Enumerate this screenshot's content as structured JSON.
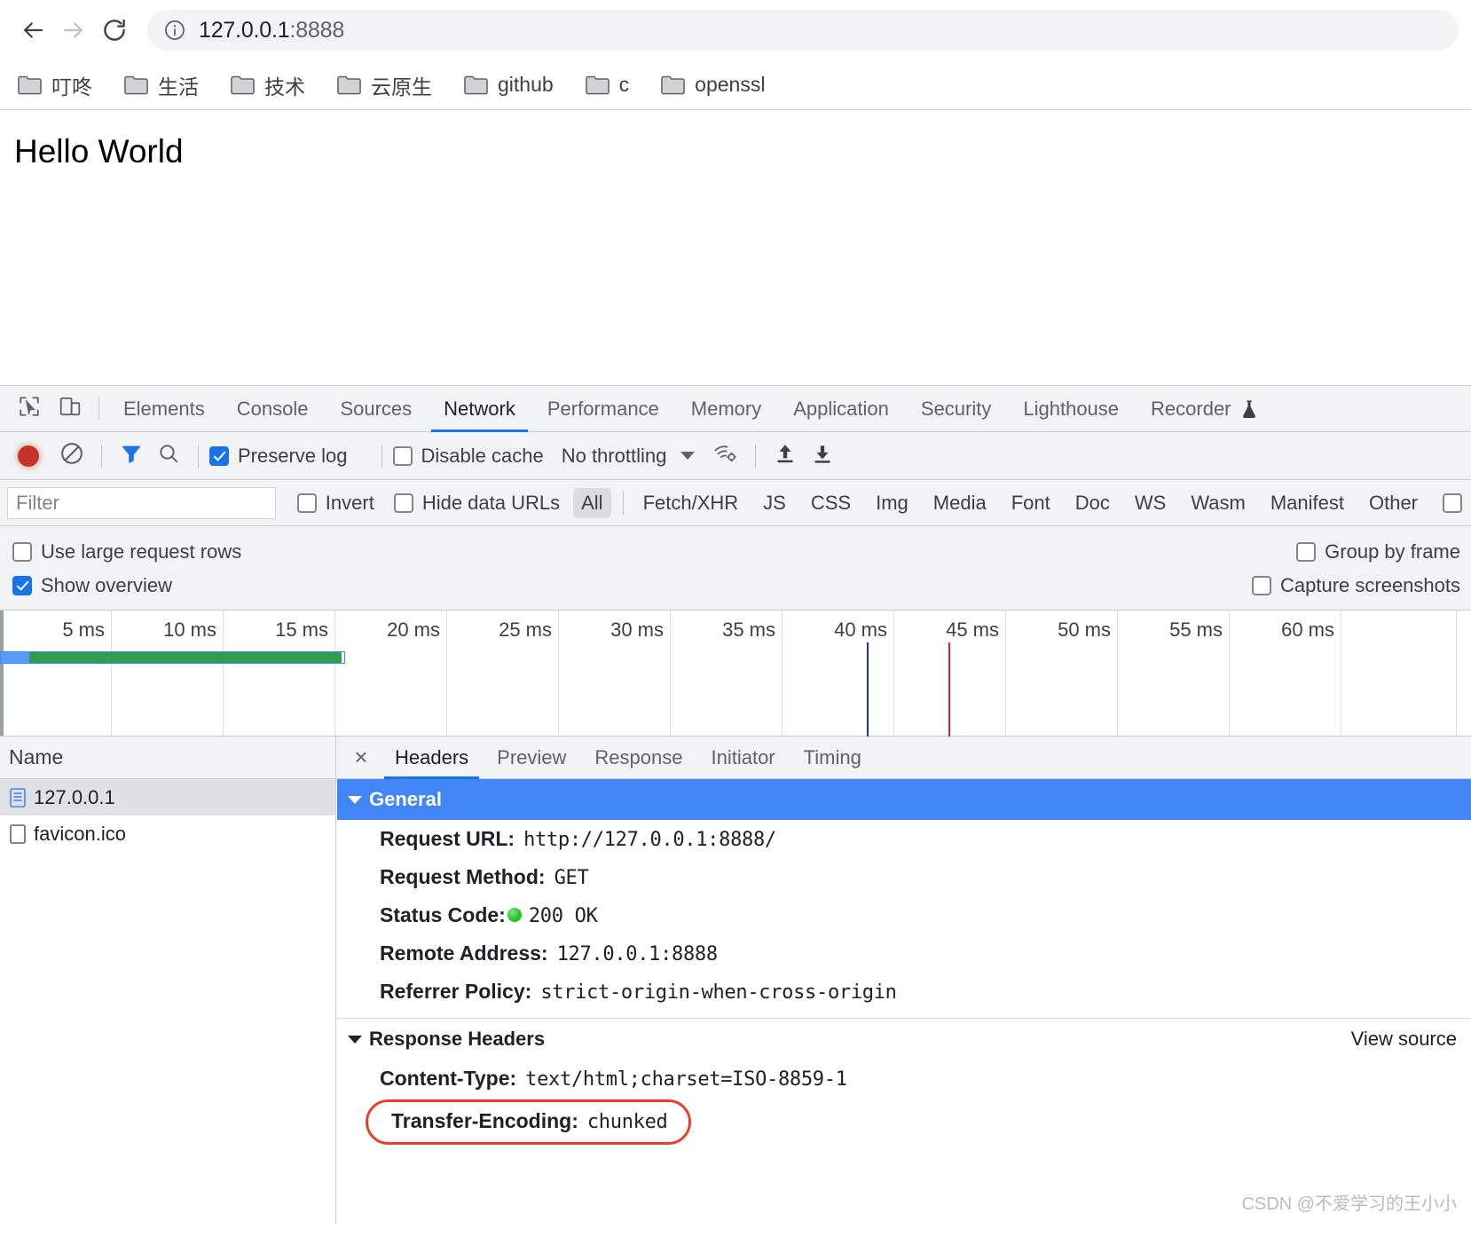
{
  "browser": {
    "nav": {
      "back_icon": "arrow-left-icon",
      "forward_icon": "arrow-right-icon",
      "reload_icon": "reload-icon"
    },
    "omnibox": {
      "info_icon": "info-circle-icon",
      "host": "127.0.0.1",
      "port": ":8888",
      "full_url": "127.0.0.1:8888"
    },
    "bookmarks": [
      {
        "label": "叮咚",
        "icon": "folder-icon"
      },
      {
        "label": "生活",
        "icon": "folder-icon"
      },
      {
        "label": "技术",
        "icon": "folder-icon"
      },
      {
        "label": "云原生",
        "icon": "folder-icon"
      },
      {
        "label": "github",
        "icon": "folder-icon"
      },
      {
        "label": "c",
        "icon": "folder-icon"
      },
      {
        "label": "openssl",
        "icon": "folder-icon"
      }
    ]
  },
  "page": {
    "heading": "Hello World"
  },
  "devtools": {
    "inspect_icon": "inspect-cursor-icon",
    "device_icon": "device-toggle-icon",
    "tabs": [
      {
        "label": "Elements",
        "active": false
      },
      {
        "label": "Console",
        "active": false
      },
      {
        "label": "Sources",
        "active": false
      },
      {
        "label": "Network",
        "active": true
      },
      {
        "label": "Performance",
        "active": false
      },
      {
        "label": "Memory",
        "active": false
      },
      {
        "label": "Application",
        "active": false
      },
      {
        "label": "Security",
        "active": false
      },
      {
        "label": "Lighthouse",
        "active": false
      },
      {
        "label": "Recorder",
        "active": false
      }
    ],
    "recorder_flask_icon": "flask-icon",
    "toolbar": {
      "record_icon": "record-button-icon",
      "clear_icon": "clear-icon",
      "filter_icon": "filter-funnel-icon",
      "search_icon": "search-icon",
      "preserve_log": {
        "label": "Preserve log",
        "checked": true
      },
      "disable_cache": {
        "label": "Disable cache",
        "checked": false
      },
      "throttling": "No throttling",
      "throttle_caret_icon": "chevron-down-icon",
      "wifi_icon": "network-conditions-icon",
      "import_icon": "upload-har-icon",
      "export_icon": "download-har-icon"
    },
    "filterbar": {
      "filter_placeholder": "Filter",
      "invert": {
        "label": "Invert",
        "checked": false
      },
      "hide_data_urls": {
        "label": "Hide data URLs",
        "checked": false
      },
      "types": [
        {
          "label": "All",
          "selected": true
        },
        {
          "label": "Fetch/XHR",
          "selected": false
        },
        {
          "label": "JS",
          "selected": false
        },
        {
          "label": "CSS",
          "selected": false
        },
        {
          "label": "Img",
          "selected": false
        },
        {
          "label": "Media",
          "selected": false
        },
        {
          "label": "Font",
          "selected": false
        },
        {
          "label": "Doc",
          "selected": false
        },
        {
          "label": "WS",
          "selected": false
        },
        {
          "label": "Wasm",
          "selected": false
        },
        {
          "label": "Manifest",
          "selected": false
        },
        {
          "label": "Other",
          "selected": false
        }
      ],
      "has_blocked_cookies_checkbox": true
    },
    "options": {
      "use_large_request_rows": {
        "label": "Use large request rows",
        "checked": false
      },
      "show_overview": {
        "label": "Show overview",
        "checked": true
      },
      "group_by_frame": {
        "label": "Group by frame",
        "checked": false
      },
      "capture_screenshots": {
        "label": "Capture screenshots",
        "checked": false
      }
    },
    "overview": {
      "tick_labels": [
        "5 ms",
        "10 ms",
        "15 ms",
        "20 ms",
        "25 ms",
        "30 ms",
        "35 ms",
        "40 ms",
        "45 ms",
        "50 ms",
        "55 ms",
        "60 ms"
      ],
      "dom_content_loaded_color": "#1a2fd0",
      "load_event_color": "#d6222b",
      "dom_content_loaded_at_ms": 40,
      "load_event_at_ms": 45,
      "request_bar_end_ms": 15.5,
      "request_bar_colors": {
        "outline": "#4285f4",
        "waiting": "#5b9bf8",
        "download": "#2e9e4a"
      }
    },
    "requests": {
      "column_header": "Name",
      "rows": [
        {
          "name": "127.0.0.1",
          "icon": "document-icon",
          "selected": true
        },
        {
          "name": "favicon.ico",
          "icon": "generic-file-icon",
          "selected": false
        }
      ]
    },
    "detail": {
      "close_label": "×",
      "tabs": [
        {
          "label": "Headers",
          "active": true
        },
        {
          "label": "Preview",
          "active": false
        },
        {
          "label": "Response",
          "active": false
        },
        {
          "label": "Initiator",
          "active": false
        },
        {
          "label": "Timing",
          "active": false
        }
      ],
      "general": {
        "title": "General",
        "rows": [
          {
            "key": "Request URL:",
            "value": "http://127.0.0.1:8888/"
          },
          {
            "key": "Request Method:",
            "value": "GET"
          },
          {
            "key": "Status Code:",
            "value": "200 OK",
            "status_dot": true
          },
          {
            "key": "Remote Address:",
            "value": "127.0.0.1:8888"
          },
          {
            "key": "Referrer Policy:",
            "value": "strict-origin-when-cross-origin"
          }
        ]
      },
      "response_headers": {
        "title": "Response Headers",
        "view_source": "View source",
        "rows": [
          {
            "key": "Content-Type:",
            "value": "text/html;charset=ISO-8859-1",
            "highlighted": false
          },
          {
            "key": "Transfer-Encoding:",
            "value": "chunked",
            "highlighted": true
          }
        ]
      }
    }
  },
  "watermark": "CSDN @不爱学习的王小小"
}
